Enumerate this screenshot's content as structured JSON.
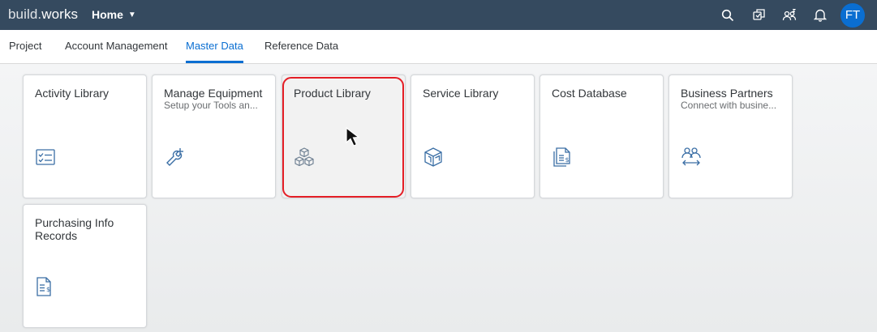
{
  "shell": {
    "logo_light": "build.",
    "logo_bold": "works",
    "home_label": "Home",
    "avatar_initials": "FT",
    "icons": [
      "search-icon",
      "product-switch-icon",
      "user-groups-icon",
      "notification-bell-icon"
    ]
  },
  "tabs": [
    {
      "label": "Project",
      "active": false
    },
    {
      "label": "Account Management",
      "active": false
    },
    {
      "label": "Master Data",
      "active": true
    },
    {
      "label": "Reference Data",
      "active": false
    }
  ],
  "tiles": [
    {
      "title": "Activity Library",
      "subtitle": "",
      "icon": "checklist-icon"
    },
    {
      "title": "Manage Equipment",
      "subtitle": "Setup your Tools an...",
      "icon": "wrench-add-icon"
    },
    {
      "title": "Product Library",
      "subtitle": "",
      "icon": "cubes-icon",
      "highlighted": true
    },
    {
      "title": "Service Library",
      "subtitle": "",
      "icon": "service-box-icon"
    },
    {
      "title": "Cost Database",
      "subtitle": "",
      "icon": "cost-document-icon"
    },
    {
      "title": "Business Partners",
      "subtitle": "Connect with busine...",
      "icon": "business-partners-icon"
    },
    {
      "title": "Purchasing Info Records",
      "subtitle": "",
      "icon": "purchasing-document-icon"
    }
  ],
  "colors": {
    "shell_bg": "#354a5f",
    "accent": "#0a6ed1",
    "icon": "#3a6ea5",
    "highlight_border": "#e41e26"
  }
}
